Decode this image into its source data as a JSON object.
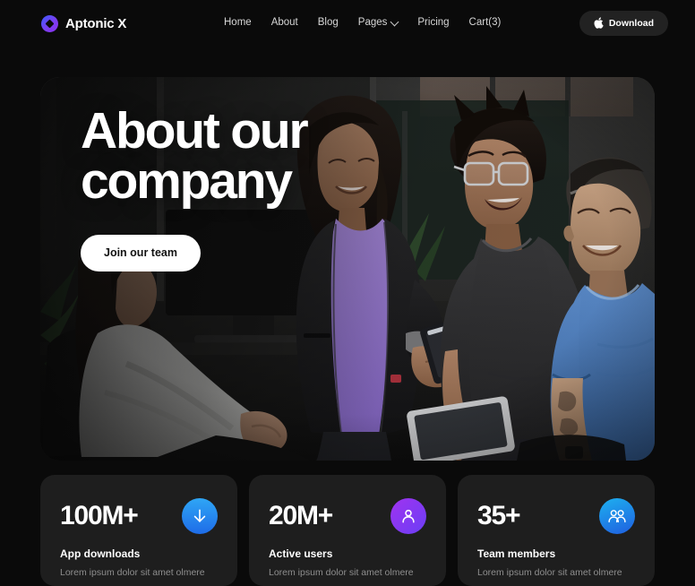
{
  "theme": {
    "background": "#0a0a0a",
    "card_background": "#1e1e1e",
    "text_primary": "#ffffff",
    "text_muted": "#8e8e8e",
    "accent_blue": "#1e6ce8",
    "accent_purple": "#7b3ef0"
  },
  "header": {
    "logo_icon": "diamond-logo-icon",
    "brand": "Aptonic X",
    "nav": [
      {
        "label": "Home",
        "has_dropdown": false
      },
      {
        "label": "About",
        "has_dropdown": false
      },
      {
        "label": "Blog",
        "has_dropdown": false
      },
      {
        "label": "Pages",
        "has_dropdown": true,
        "dropdown_icon": "chevron-down-icon"
      },
      {
        "label": "Pricing",
        "has_dropdown": false
      },
      {
        "label": "Cart(3)",
        "has_dropdown": false
      }
    ],
    "download": {
      "label": "Download",
      "icon": "apple-logo-icon",
      "glyph": ""
    }
  },
  "hero": {
    "title_line1": "About our",
    "title_line2": "company",
    "cta_label": "Join our team",
    "image_alt": "Four colleagues in a modern office laughing together around a tablet"
  },
  "stats": [
    {
      "value": "100M+",
      "label": "App downloads",
      "description": "Lorem ipsum dolor sit amet olmere",
      "icon": "download-arrow-icon",
      "icon_color": "#1e6ce8"
    },
    {
      "value": "20M+",
      "label": "Active users",
      "description": "Lorem ipsum dolor sit amet olmere",
      "icon": "user-icon",
      "icon_color": "#7b3ef0"
    },
    {
      "value": "35+",
      "label": "Team members",
      "description": "Lorem ipsum dolor sit amet olmere",
      "icon": "users-group-icon",
      "icon_color": "#1f7fe0"
    }
  ]
}
